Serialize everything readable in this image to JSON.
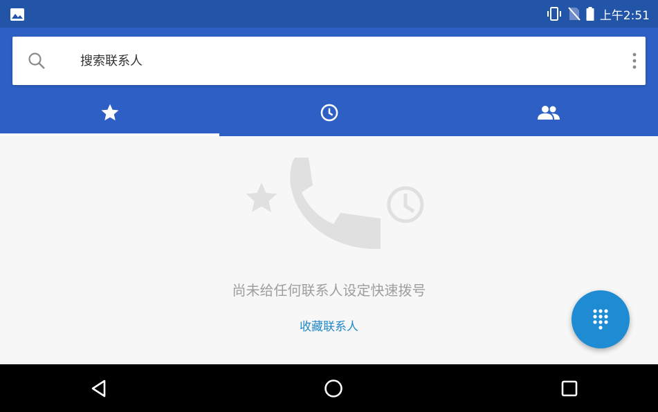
{
  "status_bar": {
    "time": "上午2:51",
    "icons": [
      "gallery-icon",
      "vibrate-icon",
      "no-sim-icon",
      "battery-icon"
    ]
  },
  "search": {
    "placeholder": "搜索联系人",
    "value": "",
    "icons": [
      "search-icon",
      "more-vert-icon"
    ]
  },
  "tabs": [
    {
      "icon": "star-icon",
      "selected": true
    },
    {
      "icon": "clock-icon",
      "selected": false
    },
    {
      "icon": "people-icon",
      "selected": false
    }
  ],
  "empty_state": {
    "message": "尚未给任何联系人设定快速拨号",
    "action": "收藏联系人",
    "illustration_icons": [
      "star-icon",
      "phone-icon",
      "clock-icon"
    ]
  },
  "fab": {
    "icon": "dialpad-icon"
  },
  "nav_bar": {
    "buttons": [
      "back-icon",
      "home-icon",
      "recents-icon"
    ]
  },
  "colors": {
    "status_bar": "#2255a8",
    "header": "#2d5fc5",
    "accent": "#1e8bd2",
    "link": "#1e88c8",
    "background": "#f7f7f7"
  }
}
